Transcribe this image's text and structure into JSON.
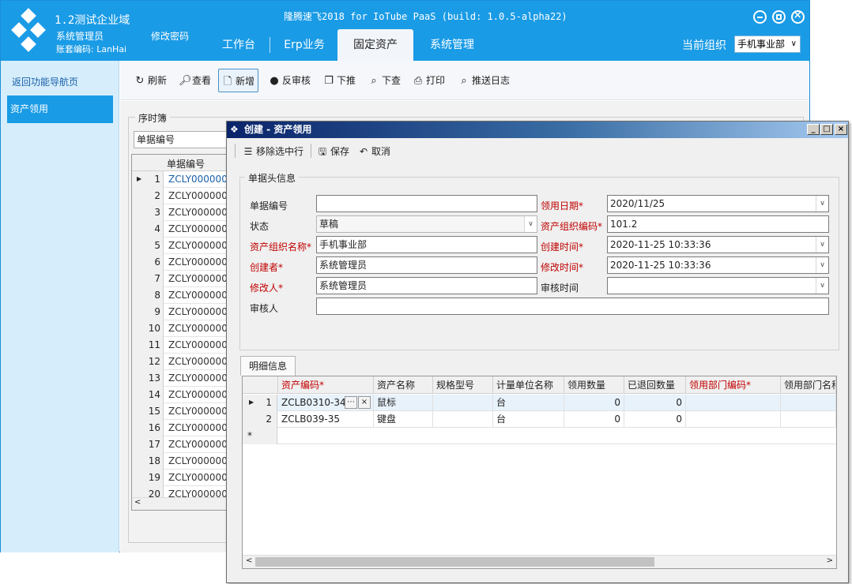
{
  "app": {
    "title": "隆腾速飞2018 for IoTube PaaS (build: 1.0.5-alpha22)",
    "corp_name": "1.2测试企业域",
    "user_role": "系统管理员",
    "account_code": "账套编码: LanHai",
    "change_password": "修改密码",
    "current_org_label": "当前组织",
    "current_org_value": "手机事业部"
  },
  "tabs": [
    {
      "label": "工作台",
      "active": false
    },
    {
      "label": "Erp业务",
      "active": false
    },
    {
      "label": "固定资产",
      "active": true
    },
    {
      "label": "系统管理",
      "active": false
    }
  ],
  "sidebar": {
    "back_label": "返回功能导航页",
    "items": [
      {
        "label": "资产领用",
        "active": true
      }
    ]
  },
  "toolbar": {
    "refresh": "刷新",
    "view": "查看",
    "add": "新增",
    "unaudit": "反审核",
    "push_down": "下推",
    "look_down": "下查",
    "print": "打印",
    "push_log": "推送日志"
  },
  "list": {
    "group_title": "序时簿",
    "search_placeholder": "单据编号",
    "column": "单据编号",
    "rows": [
      {
        "n": "1",
        "code": "ZCLY000000"
      },
      {
        "n": "2",
        "code": "ZCLY000000"
      },
      {
        "n": "3",
        "code": "ZCLY000000"
      },
      {
        "n": "4",
        "code": "ZCLY000000"
      },
      {
        "n": "5",
        "code": "ZCLY000000"
      },
      {
        "n": "6",
        "code": "ZCLY000000"
      },
      {
        "n": "7",
        "code": "ZCLY000000"
      },
      {
        "n": "8",
        "code": "ZCLY000000"
      },
      {
        "n": "9",
        "code": "ZCLY000000"
      },
      {
        "n": "10",
        "code": "ZCLY000000"
      },
      {
        "n": "11",
        "code": "ZCLY000000"
      },
      {
        "n": "12",
        "code": "ZCLY000000"
      },
      {
        "n": "13",
        "code": "ZCLY000000"
      },
      {
        "n": "14",
        "code": "ZCLY000000"
      },
      {
        "n": "15",
        "code": "ZCLY000000"
      },
      {
        "n": "16",
        "code": "ZCLY000000"
      },
      {
        "n": "17",
        "code": "ZCLY000000"
      },
      {
        "n": "18",
        "code": "ZCLY000000"
      },
      {
        "n": "19",
        "code": "ZCLY000000"
      },
      {
        "n": "20",
        "code": "ZCLY000000"
      }
    ]
  },
  "dialog": {
    "title": "创建 - 资产领用",
    "toolbar": {
      "remove_row": "移除选中行",
      "save": "保存",
      "cancel": "取消"
    },
    "header_group": "单据头信息",
    "fields": {
      "bill_no_label": "单据编号",
      "bill_no_value": "",
      "date_label": "领用日期*",
      "date_value": "2020/11/25",
      "status_label": "状态",
      "status_value": "草稿",
      "org_code_label": "资产组织编码*",
      "org_code_value": "101.2",
      "org_name_label": "资产组织名称*",
      "org_name_value": "手机事业部",
      "created_label": "创建时间*",
      "created_value": "2020-11-25 10:33:36",
      "creator_label": "创建者*",
      "creator_value": "系统管理员",
      "modified_label": "修改时间*",
      "modified_value": "2020-11-25 10:33:36",
      "modifier_label": "修改人*",
      "modifier_value": "系统管理员",
      "audit_time_label": "审核时间",
      "audit_time_value": "",
      "auditor_label": "审核人",
      "auditor_value": ""
    },
    "detail_tab": "明细信息",
    "detail_columns": [
      "资产编码*",
      "资产名称",
      "规格型号",
      "计量单位名称",
      "领用数量",
      "已退回数量",
      "领用部门编码*",
      "领用部门名称"
    ],
    "detail_rows": [
      {
        "n": "1",
        "code": "ZCLB0310-34",
        "name": "鼠标",
        "spec": "",
        "unit": "台",
        "qty": "0",
        "returned": "0",
        "dept_code": "",
        "dept_name": ""
      },
      {
        "n": "2",
        "code": "ZCLB039-35",
        "name": "键盘",
        "spec": "",
        "unit": "台",
        "qty": "0",
        "returned": "0",
        "dept_code": "",
        "dept_name": ""
      }
    ],
    "new_row_marker": "*"
  },
  "colors": {
    "header_blue": "#1a9be6",
    "sidebar_bg": "#d6eefc",
    "required_red": "#c00000"
  }
}
